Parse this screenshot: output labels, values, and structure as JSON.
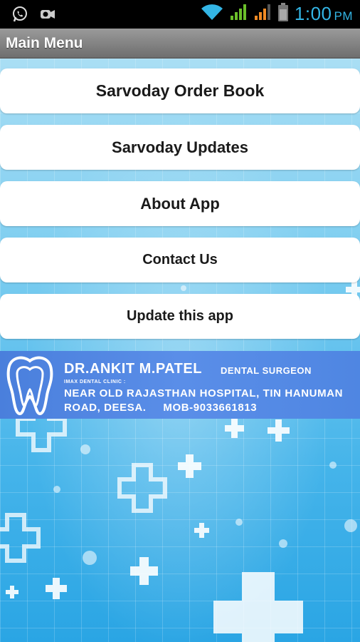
{
  "status_bar": {
    "time": "1:00",
    "ampm": "PM",
    "icons": [
      "whatsapp-icon",
      "camera-notification-icon",
      "wifi-icon",
      "signal-icon",
      "signal-icon-2",
      "battery-icon"
    ]
  },
  "titlebar": {
    "title": "Main Menu"
  },
  "menu": {
    "items": [
      {
        "label": "Sarvoday Order Book"
      },
      {
        "label": "Sarvoday Updates"
      },
      {
        "label": "About App"
      },
      {
        "label": "Contact Us"
      },
      {
        "label": "Update this app"
      }
    ]
  },
  "banner": {
    "name": "DR.ANKIT M.PATEL",
    "role": "DENTAL SURGEON",
    "clinic": "IMAX DENTAL CLINIC :",
    "address_line1": "NEAR OLD RAJASTHAN HOSPITAL, TIN HANUMAN",
    "address_line2": "ROAD, DEESA.     MOB-9033661813"
  },
  "colors": {
    "accent": "#33b5e5",
    "banner": "#5a8ee8",
    "background": "#45b4ea"
  }
}
